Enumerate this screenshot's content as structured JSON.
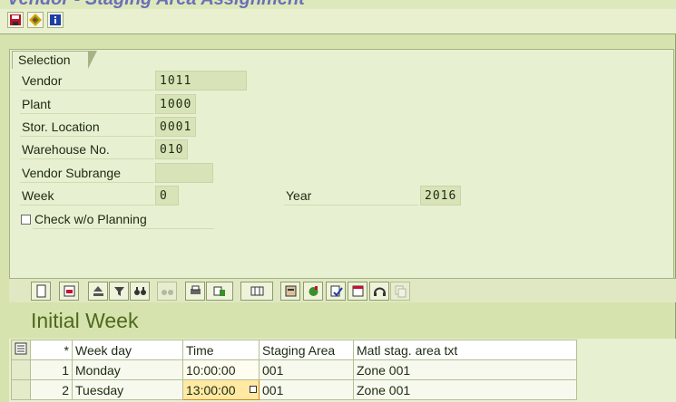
{
  "window": {
    "title": "Vendor - Staging Area Assignment"
  },
  "toolbar": {
    "buttons": [
      {
        "name": "save-icon"
      },
      {
        "name": "execute-icon"
      },
      {
        "name": "info-icon"
      }
    ]
  },
  "selection": {
    "tab_label": "Selection",
    "fields": {
      "vendor": {
        "label": "Vendor",
        "value": "1011"
      },
      "plant": {
        "label": "Plant",
        "value": "1000"
      },
      "stor_location": {
        "label": "Stor. Location",
        "value": "0001"
      },
      "warehouse_no": {
        "label": "Warehouse No.",
        "value": "010"
      },
      "vendor_subrange": {
        "label": "Vendor Subrange",
        "value": ""
      },
      "week": {
        "label": "Week",
        "value": "0"
      },
      "year": {
        "label": "Year",
        "value": "2016"
      }
    },
    "check_wo_planning": {
      "label": "Check w/o Planning",
      "checked": false
    }
  },
  "grid_toolbar": {
    "buttons": [
      "details-icon",
      "delete-row-icon",
      "print-icon",
      "filter-icon",
      "find-icon",
      "find-next-icon",
      "print-preview-icon",
      "export-icon",
      "layout-icon",
      "structure-icon",
      "green-icon",
      "check-icon",
      "calendar-icon",
      "headset-icon",
      "copy-icon"
    ]
  },
  "section": {
    "title": "Initial Week"
  },
  "grid": {
    "columns": [
      "*",
      "Week day",
      "Time",
      "Staging Area",
      "Matl stag. area txt"
    ],
    "rows": [
      {
        "num": "1",
        "weekday": "Monday",
        "time": "10:00:00",
        "staging_area": "001",
        "txt": "Zone 001"
      },
      {
        "num": "2",
        "weekday": "Tuesday",
        "time": "13:00:00",
        "staging_area": "001",
        "txt": "Zone 001"
      }
    ]
  }
}
